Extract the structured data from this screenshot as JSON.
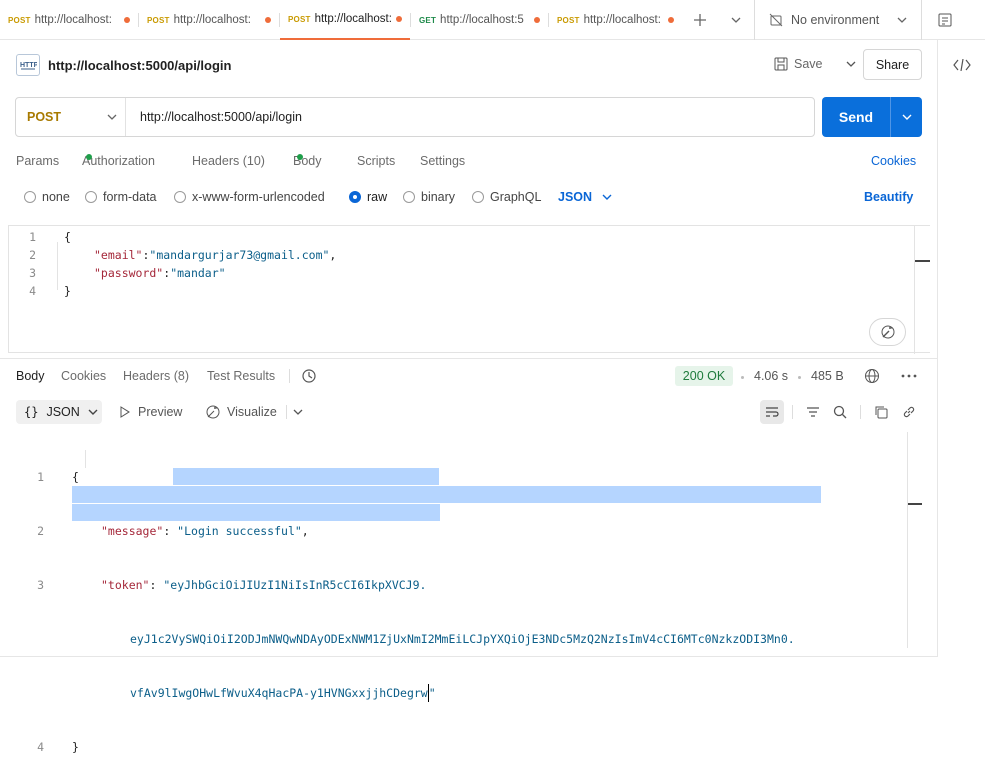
{
  "tabs": [
    {
      "method": "POST",
      "url": "http://localhost:"
    },
    {
      "method": "POST",
      "url": "http://localhost:"
    },
    {
      "method": "POST",
      "url": "http://localhost:"
    },
    {
      "method": "GET",
      "url": "http://localhost:5"
    },
    {
      "method": "POST",
      "url": "http://localhost:"
    }
  ],
  "environment": "No environment",
  "request": {
    "title": "http://localhost:5000/api/login",
    "save_label": "Save",
    "share_label": "Share",
    "method": "POST",
    "url": "http://localhost:5000/api/login",
    "send_label": "Send"
  },
  "req_tabs": {
    "params": "Params",
    "authorization": "Authorization",
    "headers": "Headers (10)",
    "body": "Body",
    "scripts": "Scripts",
    "settings": "Settings",
    "cookies": "Cookies"
  },
  "body_types": {
    "none": "none",
    "form_data": "form-data",
    "urlencoded": "x-www-form-urlencoded",
    "raw": "raw",
    "binary": "binary",
    "graphql": "GraphQL",
    "format": "JSON",
    "beautify": "Beautify"
  },
  "req_body": {
    "lines": [
      "1",
      "2",
      "3",
      "4"
    ],
    "l1": "{",
    "l2_key": "\"email\"",
    "l2_val": "\"mandargurjar73@gmail.com\"",
    "l3_key": "\"password\"",
    "l3_val": "\"mandar\"",
    "l4": "}"
  },
  "resp_tabs": {
    "body": "Body",
    "cookies": "Cookies",
    "headers": "Headers (8)",
    "tests": "Test Results"
  },
  "resp_status": {
    "code": "200 OK",
    "time": "4.06 s",
    "size": "485 B"
  },
  "resp_view": {
    "format": "JSON",
    "preview": "Preview",
    "visualize": "Visualize"
  },
  "resp_body": {
    "lines": [
      "1",
      "2",
      "3",
      "4"
    ],
    "l1": "{",
    "msg_key": "\"message\"",
    "msg_val": "\"Login successful\"",
    "token_key": "\"token\"",
    "token_1": "eyJhbGciOiJIUzI1NiIsInR5cCI6IkpXVCJ9.",
    "token_2": "eyJ1c2VySWQiOiI2ODJmNWQwNDAyODExNWM1ZjUxNmI2MmEiLCJpYXQiOjE3NDc5MzQ2NzIsImV4cCI6MTc0NzkzODI3Mn0.",
    "token_3": "vfAv9lIwgOHwLfWvuX4qHacPA-y1HVNGxxjjhCDegrw",
    "l4": "}"
  }
}
